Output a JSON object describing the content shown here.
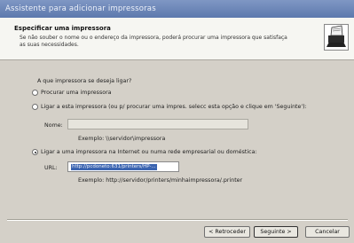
{
  "window": {
    "title": "Assistente para adicionar impressoras"
  },
  "header": {
    "title": "Especificar uma impressora",
    "description": "Se não souber o nome ou o endereço da impressora, poderá procurar uma impressora que satisfaça as suas necessidades.",
    "icon": "printer-icon"
  },
  "question": "A que impressora se deseja ligar?",
  "options": {
    "browse": {
      "label": "Procurar uma impressora",
      "selected": false
    },
    "connect": {
      "label": "Ligar a esta impressora (ou p/ procurar uma impres. selecc esta opção e clique em 'Seguinte'):",
      "selected": false,
      "name_label": "Nome:",
      "name_value": "",
      "example": "Exemplo: \\\\servidor\\impressora"
    },
    "url": {
      "label": "Ligar a uma impressora na Internet ou numa rede empresarial ou doméstica:",
      "selected": true,
      "url_label": "URL:",
      "url_value": "http://pcdoneto:631/printers/HP-...",
      "example": "Exemplo: http://servidor/printers/minhaimpressora/.printer"
    }
  },
  "buttons": {
    "back": "< Retroceder",
    "next": "Seguinte >",
    "cancel": "Cancelar"
  }
}
